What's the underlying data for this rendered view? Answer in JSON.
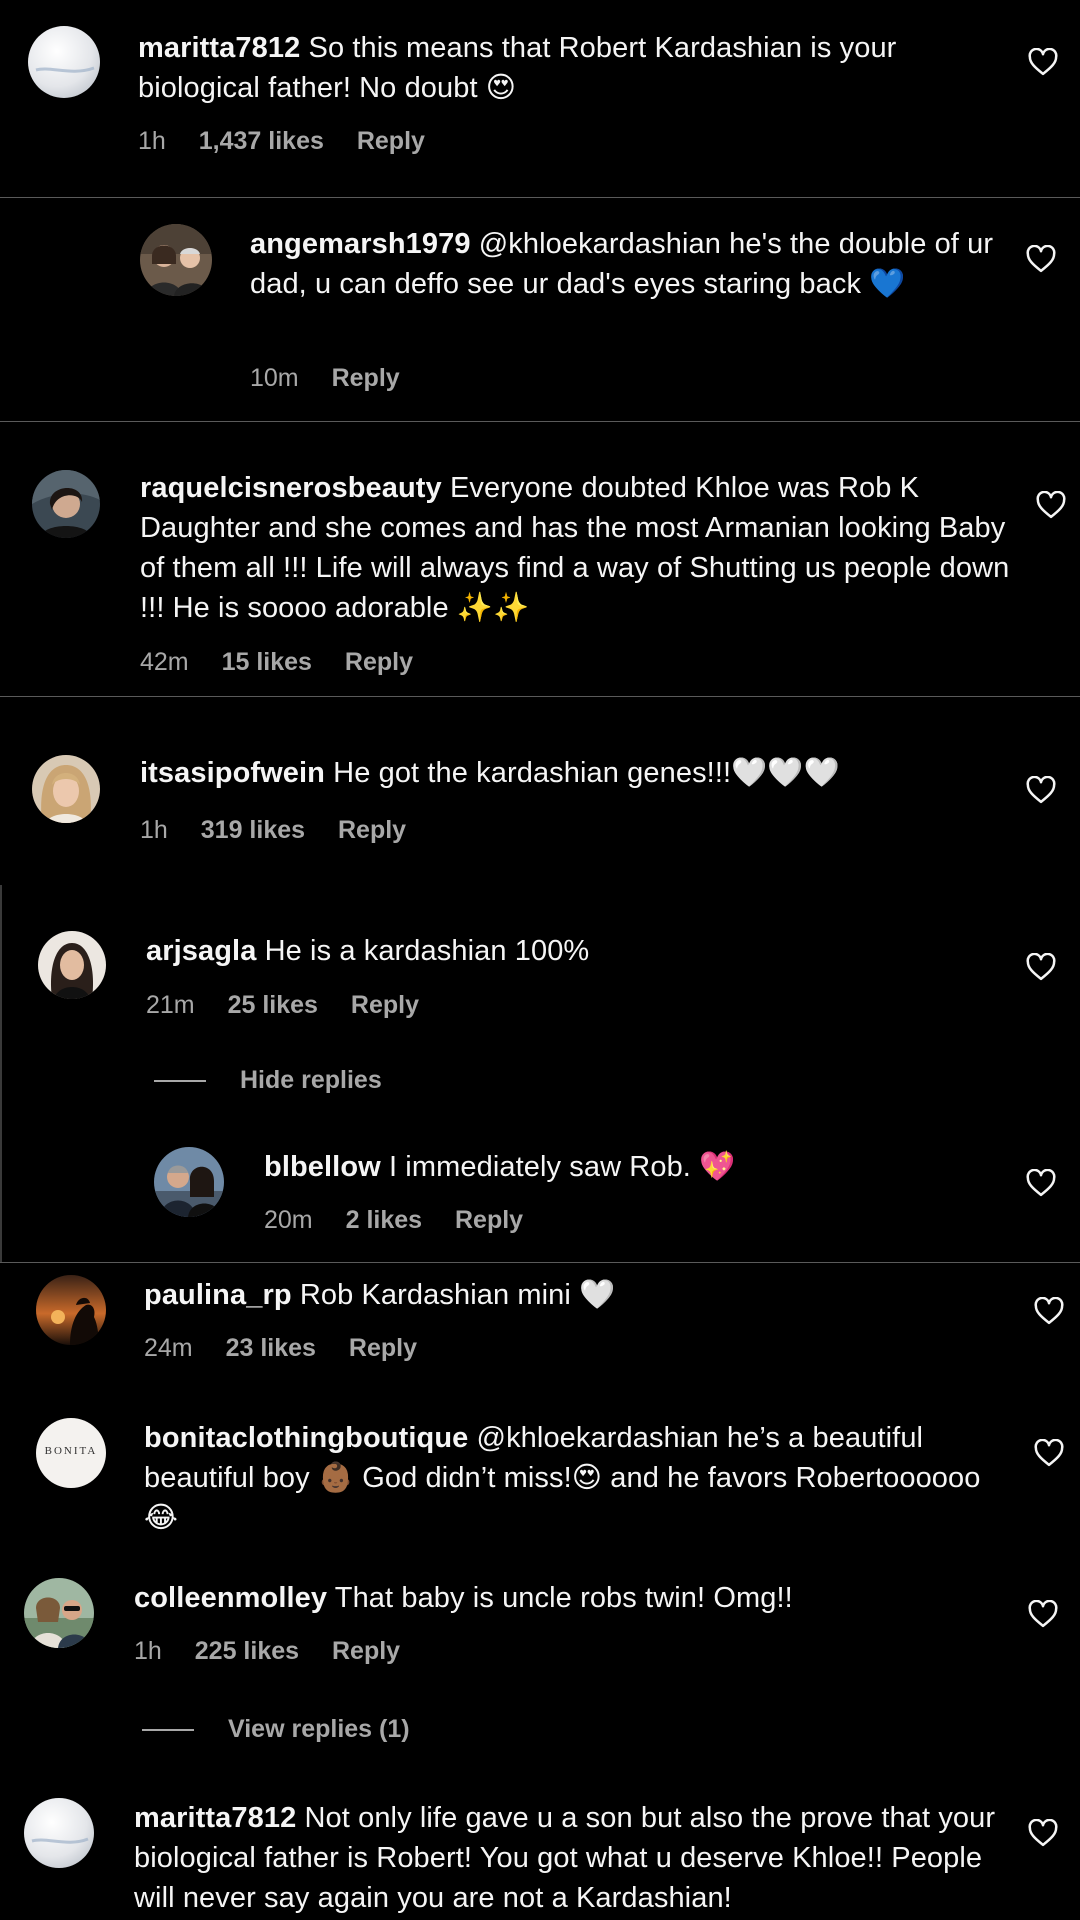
{
  "comments": [
    {
      "username": "maritta7812",
      "text": "So this means that Robert Kardashian is your biological father! No doubt 😍",
      "time": "1h",
      "likes": "1,437 likes",
      "reply": "Reply"
    },
    {
      "username": "angemarsh1979",
      "text": "@khloekardashian he's the double of ur dad, u can deffo see ur dad's eyes staring back 💙",
      "time": "10m",
      "likes": "",
      "reply": "Reply"
    },
    {
      "username": "raquelcisnerosbeauty",
      "text": "Everyone doubted Khloe was Rob K Daughter and she comes and has the most Armanian looking Baby of them all !!! Life will always find a way of Shutting us people down !!! He is soooo adorable ✨✨",
      "time": "42m",
      "likes": "15 likes",
      "reply": "Reply"
    },
    {
      "username": "itsasipofwein",
      "text": "He got the kardashian genes!!!🤍🤍🤍",
      "time": "1h",
      "likes": "319 likes",
      "reply": "Reply"
    },
    {
      "username": "arjsagla",
      "text": "He is a kardashian 100%",
      "time": "21m",
      "likes": "25 likes",
      "reply": "Reply"
    },
    {
      "username": "blbellow",
      "text": "I immediately saw Rob. 💖",
      "time": "20m",
      "likes": "2 likes",
      "reply": "Reply"
    },
    {
      "username": "paulina_rp",
      "text": "Rob Kardashian mini 🤍",
      "time": "24m",
      "likes": "23 likes",
      "reply": "Reply"
    },
    {
      "username": "bonitaclothingboutique",
      "text": "@khloekardashian he’s a beautiful beautiful boy 👶🏾 God didn’t miss!😍 and he favors Robertoooooo 😂",
      "time": "",
      "likes": "",
      "reply": ""
    },
    {
      "username": "colleenmolley",
      "text": "That baby is uncle robs twin! Omg!!",
      "time": "1h",
      "likes": "225 likes",
      "reply": "Reply"
    },
    {
      "username": "maritta7812",
      "text": "Not only life gave u a son but also the prove that your biological father is Robert! You got what u deserve Khloe!! People will never say again you are not a Kardashian!",
      "time": "",
      "likes": "",
      "reply": ""
    }
  ],
  "threads": {
    "hide_replies": "Hide replies",
    "view_replies": "View replies (1)"
  },
  "avatars": {
    "bonita_logo": "BONITA"
  },
  "icons": {
    "like": "heart-outline-icon"
  },
  "colors": {
    "background": "#000000",
    "text": "#f5f5f5",
    "secondary": "#a8a8a8",
    "divider": "#5a5a5a"
  }
}
